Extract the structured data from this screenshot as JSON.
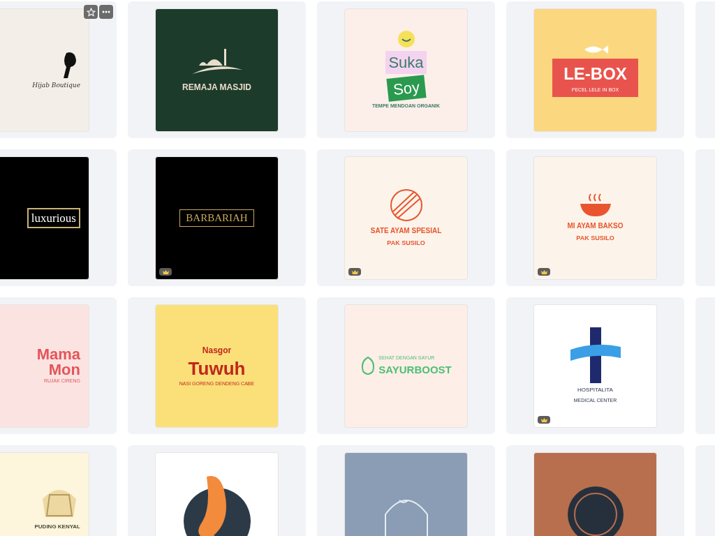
{
  "templates": [
    {
      "kind": "hijab",
      "hovered": true,
      "texts": [
        "Hijab Boutique"
      ]
    },
    {
      "kind": "masjid",
      "premium": false,
      "hovered": false,
      "texts": [
        "REMAJA MASJID"
      ]
    },
    {
      "kind": "suka",
      "premium": false,
      "hovered": false,
      "texts": [
        "Suka",
        "Soy",
        "TEMPE MENDOAN ORGANIK"
      ]
    },
    {
      "kind": "lebox",
      "premium": false,
      "hovered": false,
      "texts": [
        "LE-BOX",
        "PECEL LELE IN BOX"
      ]
    },
    {
      "kind": "blank"
    },
    {
      "kind": "luxury",
      "hovered": false,
      "texts": [
        "luxurious"
      ]
    },
    {
      "kind": "barbariah",
      "premium": true,
      "hovered": false,
      "texts": [
        "BARBARIAH"
      ]
    },
    {
      "kind": "sate",
      "premium": true,
      "hovered": false,
      "texts": [
        "SATE AYAM SPESIAL",
        "PAK SUSILO"
      ]
    },
    {
      "kind": "bakso",
      "premium": true,
      "hovered": false,
      "texts": [
        "MI AYAM BAKSO",
        "PAK SUSILO"
      ]
    },
    {
      "kind": "blank"
    },
    {
      "kind": "mama",
      "hovered": false,
      "texts": [
        "Mama",
        "Mon",
        "RUJAK CIRENG"
      ]
    },
    {
      "kind": "nasgor",
      "premium": false,
      "hovered": false,
      "texts": [
        "Nasgor",
        "Tuwuh",
        "NASI GORENG DENDENG CABE"
      ]
    },
    {
      "kind": "sayur",
      "premium": false,
      "hovered": false,
      "texts": [
        "SEHAT DENGAN SAYUR",
        "SAYURBOOST"
      ]
    },
    {
      "kind": "hospital",
      "premium": true,
      "hovered": false,
      "texts": [
        "HOSPITALITA",
        "MEDICAL CENTER"
      ]
    },
    {
      "kind": "blank"
    },
    {
      "kind": "puding",
      "hovered": false,
      "texts": [
        "PUDING KENYAL"
      ]
    },
    {
      "kind": "koi",
      "hovered": false
    },
    {
      "kind": "salford",
      "hovered": false
    },
    {
      "kind": "samara",
      "hovered": false
    },
    {
      "kind": "blank"
    }
  ]
}
